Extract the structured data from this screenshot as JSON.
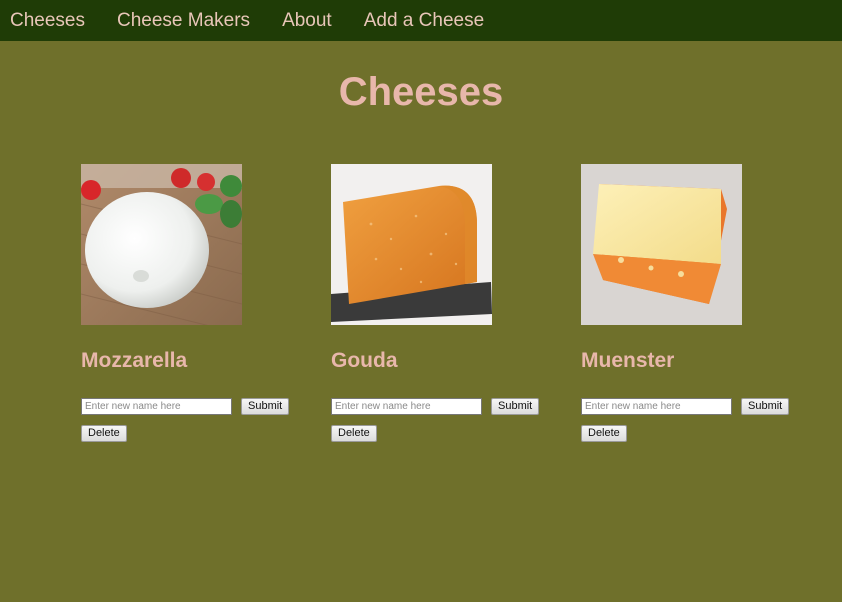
{
  "nav": {
    "items": [
      {
        "label": "Cheeses"
      },
      {
        "label": "Cheese Makers"
      },
      {
        "label": "About"
      },
      {
        "label": "Add a Cheese"
      }
    ]
  },
  "page": {
    "title": "Cheeses"
  },
  "cheeses": [
    {
      "name": "Mozzarella",
      "image": "mozzarella-photo",
      "input_placeholder": "Enter new name here",
      "submit_label": "Submit",
      "delete_label": "Delete"
    },
    {
      "name": "Gouda",
      "image": "gouda-photo",
      "input_placeholder": "Enter new name here",
      "submit_label": "Submit",
      "delete_label": "Delete"
    },
    {
      "name": "Muenster",
      "image": "muenster-photo",
      "input_placeholder": "Enter new name here",
      "submit_label": "Submit",
      "delete_label": "Delete"
    }
  ],
  "colors": {
    "page_background": "#6f702b",
    "navbar_background": "#1f3c06",
    "accent_text": "#e8b7ab"
  }
}
